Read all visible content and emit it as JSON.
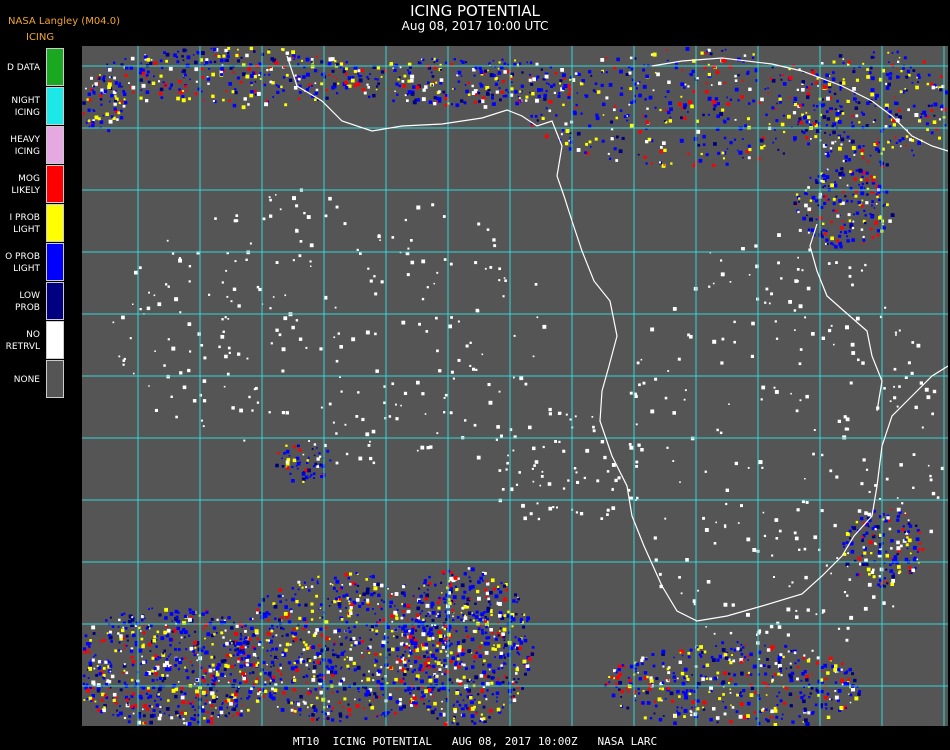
{
  "header": {
    "credit": "NASA Langley (M04.0)",
    "legend_title": "ICING",
    "title": "ICING POTENTIAL",
    "subtitle": "Aug 08, 2017 10:00 UTC"
  },
  "legend": {
    "items": [
      {
        "lines": [
          "D DATA"
        ],
        "color": "#1aa820"
      },
      {
        "lines": [
          "NIGHT",
          "ICING"
        ],
        "color": "#1de8e8"
      },
      {
        "lines": [
          "HEAVY",
          "ICING"
        ],
        "color": "#e6a8e0"
      },
      {
        "lines": [
          "MOG",
          "LIKELY"
        ],
        "color": "#ff0000"
      },
      {
        "lines": [
          "I PROB",
          "LIGHT"
        ],
        "color": "#ffff00"
      },
      {
        "lines": [
          "O PROB",
          "LIGHT"
        ],
        "color": "#0000ff"
      },
      {
        "lines": [
          "LOW",
          "PROB"
        ],
        "color": "#000080"
      },
      {
        "lines": [
          "NO",
          "RETRVL"
        ],
        "color": "#ffffff"
      },
      {
        "lines": [
          "NONE"
        ],
        "color": "#555555"
      }
    ]
  },
  "map": {
    "background_color": "#555555",
    "grid_color": "#33d6d6",
    "coastline_color": "#ffffff",
    "grid_label_color": "#c0392b"
  },
  "footer": {
    "text": "MT10  ICING POTENTIAL   AUG 08, 2017 10:00Z   NASA LARC"
  }
}
